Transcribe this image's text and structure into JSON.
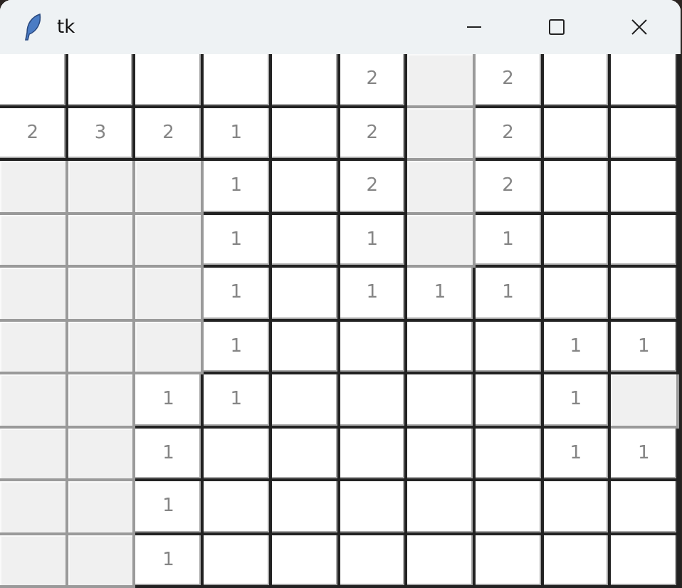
{
  "window": {
    "title": "tk"
  },
  "grid": {
    "rows": [
      [
        {
          "kind": "button"
        },
        {
          "kind": "button"
        },
        {
          "kind": "button"
        },
        {
          "kind": "button"
        },
        {
          "kind": "button"
        },
        {
          "kind": "button",
          "text": "2"
        },
        {
          "kind": "flat"
        },
        {
          "kind": "button",
          "text": "2"
        },
        {
          "kind": "button"
        },
        {
          "kind": "button"
        }
      ],
      [
        {
          "kind": "button",
          "text": "2"
        },
        {
          "kind": "button",
          "text": "3"
        },
        {
          "kind": "button",
          "text": "2"
        },
        {
          "kind": "button",
          "text": "1"
        },
        {
          "kind": "button"
        },
        {
          "kind": "button",
          "text": "2"
        },
        {
          "kind": "flat"
        },
        {
          "kind": "button",
          "text": "2"
        },
        {
          "kind": "button"
        },
        {
          "kind": "button"
        }
      ],
      [
        {
          "kind": "flat"
        },
        {
          "kind": "flat"
        },
        {
          "kind": "flat"
        },
        {
          "kind": "button",
          "text": "1"
        },
        {
          "kind": "button"
        },
        {
          "kind": "button",
          "text": "2"
        },
        {
          "kind": "flat"
        },
        {
          "kind": "button",
          "text": "2"
        },
        {
          "kind": "button"
        },
        {
          "kind": "button"
        }
      ],
      [
        {
          "kind": "flat"
        },
        {
          "kind": "flat"
        },
        {
          "kind": "flat"
        },
        {
          "kind": "button",
          "text": "1"
        },
        {
          "kind": "button"
        },
        {
          "kind": "button",
          "text": "1"
        },
        {
          "kind": "flat"
        },
        {
          "kind": "button",
          "text": "1"
        },
        {
          "kind": "button"
        },
        {
          "kind": "button"
        }
      ],
      [
        {
          "kind": "flat"
        },
        {
          "kind": "flat"
        },
        {
          "kind": "flat"
        },
        {
          "kind": "button",
          "text": "1"
        },
        {
          "kind": "button"
        },
        {
          "kind": "button",
          "text": "1"
        },
        {
          "kind": "button",
          "text": "1"
        },
        {
          "kind": "button",
          "text": "1"
        },
        {
          "kind": "button"
        },
        {
          "kind": "button"
        }
      ],
      [
        {
          "kind": "flat"
        },
        {
          "kind": "flat"
        },
        {
          "kind": "flat"
        },
        {
          "kind": "button",
          "text": "1"
        },
        {
          "kind": "button"
        },
        {
          "kind": "button"
        },
        {
          "kind": "button"
        },
        {
          "kind": "button"
        },
        {
          "kind": "button",
          "text": "1"
        },
        {
          "kind": "button",
          "text": "1"
        }
      ],
      [
        {
          "kind": "flat"
        },
        {
          "kind": "flat"
        },
        {
          "kind": "button",
          "text": "1"
        },
        {
          "kind": "button",
          "text": "1"
        },
        {
          "kind": "button"
        },
        {
          "kind": "button"
        },
        {
          "kind": "button"
        },
        {
          "kind": "button"
        },
        {
          "kind": "button",
          "text": "1"
        },
        {
          "kind": "flat"
        }
      ],
      [
        {
          "kind": "flat"
        },
        {
          "kind": "flat"
        },
        {
          "kind": "button",
          "text": "1"
        },
        {
          "kind": "button"
        },
        {
          "kind": "button"
        },
        {
          "kind": "button"
        },
        {
          "kind": "button"
        },
        {
          "kind": "button"
        },
        {
          "kind": "button",
          "text": "1"
        },
        {
          "kind": "button",
          "text": "1"
        }
      ],
      [
        {
          "kind": "flat"
        },
        {
          "kind": "flat"
        },
        {
          "kind": "button",
          "text": "1"
        },
        {
          "kind": "button"
        },
        {
          "kind": "button"
        },
        {
          "kind": "button"
        },
        {
          "kind": "button"
        },
        {
          "kind": "button"
        },
        {
          "kind": "button"
        },
        {
          "kind": "button"
        }
      ],
      [
        {
          "kind": "flat"
        },
        {
          "kind": "flat"
        },
        {
          "kind": "button",
          "text": "1"
        },
        {
          "kind": "button"
        },
        {
          "kind": "button"
        },
        {
          "kind": "button"
        },
        {
          "kind": "button"
        },
        {
          "kind": "button"
        },
        {
          "kind": "button"
        },
        {
          "kind": "button"
        }
      ]
    ]
  }
}
